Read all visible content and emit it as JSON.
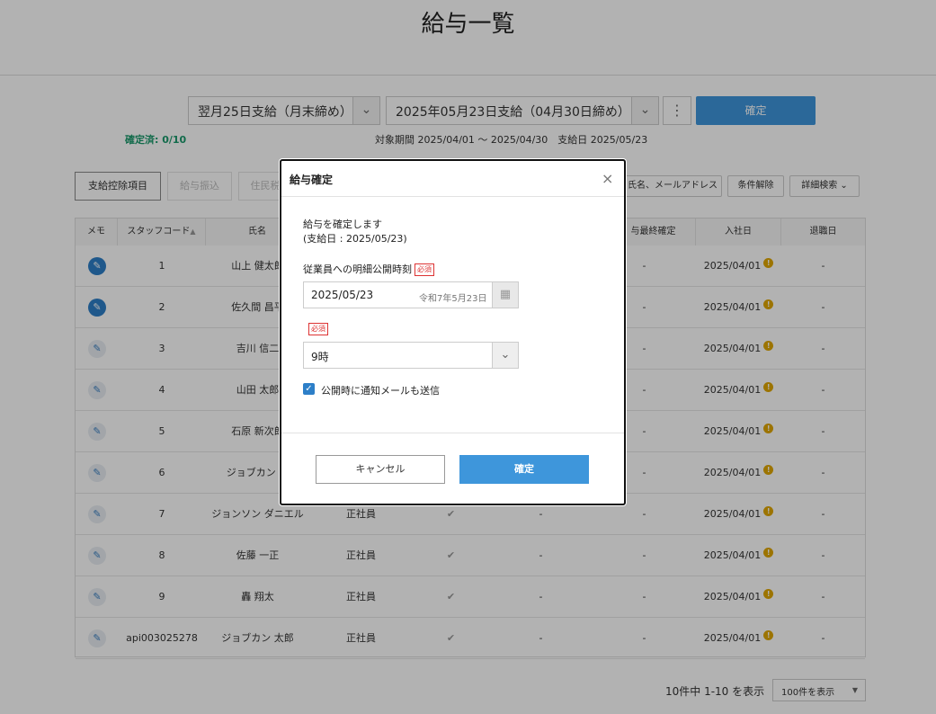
{
  "page": {
    "title": "給与一覧"
  },
  "filters": {
    "pay_schedule": "翌月25日支給（月末締め）",
    "pay_date": "2025年05月23日支給（04月30日締め）",
    "kebab": "⋮",
    "confirm_label": "確定",
    "confirmed_count": "確定済: 0/10",
    "period_text": "対象期間 2025/04/01 〜 2025/04/30　支給日 2025/05/23"
  },
  "toolbar": {
    "deduction_items": "支給控除項目",
    "salary_transfer": "給与振込",
    "resident_tax": "住民税",
    "search_placeholder": "氏名、メールアドレス",
    "clear_conditions": "条件解除",
    "advanced_search": "詳細検索"
  },
  "table": {
    "headers": {
      "memo": "メモ",
      "staff_code": "スタッフコード",
      "name": "氏名",
      "final_confirm": "与最終確定",
      "join_date": "入社日",
      "leave_date": "退職日"
    },
    "rows": [
      {
        "code": "1",
        "name": "山上 健太郎",
        "type": "",
        "check": "",
        "misc": "",
        "final": "-",
        "join": "2025/04/01",
        "leave": "-",
        "memo_filled": true
      },
      {
        "code": "2",
        "name": "佐久間 昌平",
        "type": "",
        "check": "",
        "misc": "",
        "final": "-",
        "join": "2025/04/01",
        "leave": "-",
        "memo_filled": true
      },
      {
        "code": "3",
        "name": "吉川 信二",
        "type": "",
        "check": "",
        "misc": "",
        "final": "-",
        "join": "2025/04/01",
        "leave": "-",
        "memo_filled": false
      },
      {
        "code": "4",
        "name": "山田 太郎",
        "type": "",
        "check": "",
        "misc": "",
        "final": "-",
        "join": "2025/04/01",
        "leave": "-",
        "memo_filled": false
      },
      {
        "code": "5",
        "name": "石原 新次郎",
        "type": "",
        "check": "",
        "misc": "",
        "final": "-",
        "join": "2025/04/01",
        "leave": "-",
        "memo_filled": false
      },
      {
        "code": "6",
        "name": "ジョブカン め",
        "type": "",
        "check": "",
        "misc": "",
        "final": "-",
        "join": "2025/04/01",
        "leave": "-",
        "memo_filled": false
      },
      {
        "code": "7",
        "name": "ジョンソン ダニエル",
        "type": "正社員",
        "check": "✔",
        "misc": "-",
        "final": "-",
        "join": "2025/04/01",
        "leave": "-",
        "memo_filled": false
      },
      {
        "code": "8",
        "name": "佐藤 一正",
        "type": "正社員",
        "check": "✔",
        "misc": "-",
        "final": "-",
        "join": "2025/04/01",
        "leave": "-",
        "memo_filled": false
      },
      {
        "code": "9",
        "name": "轟 翔太",
        "type": "正社員",
        "check": "✔",
        "misc": "-",
        "final": "-",
        "join": "2025/04/01",
        "leave": "-",
        "memo_filled": false
      },
      {
        "code": "api003025278",
        "name": "ジョブカン 太郎",
        "type": "正社員",
        "check": "✔",
        "misc": "-",
        "final": "-",
        "join": "2025/04/01",
        "leave": "-",
        "memo_filled": false
      }
    ]
  },
  "pager": {
    "summary": "10件中 1-10 を表示",
    "per_page": "100件を表示"
  },
  "modal": {
    "title": "給与確定",
    "close": "×",
    "message_line1": "給与を確定します",
    "message_line2": "(支給日 : 2025/05/23)",
    "publish_label": "従業員への明細公開時刻",
    "required": "必須",
    "date_value": "2025/05/23",
    "wareki": "令和7年5月23日",
    "time_value": "9時",
    "notify_label": "公開時に通知メールも送信",
    "notify_checked": true,
    "cancel": "キャンセル",
    "confirm": "確定"
  },
  "colors": {
    "primary": "#3e96db",
    "confirmed_green": "#1a9a6c",
    "required_red": "#dd3333",
    "warn": "#e0a600"
  }
}
